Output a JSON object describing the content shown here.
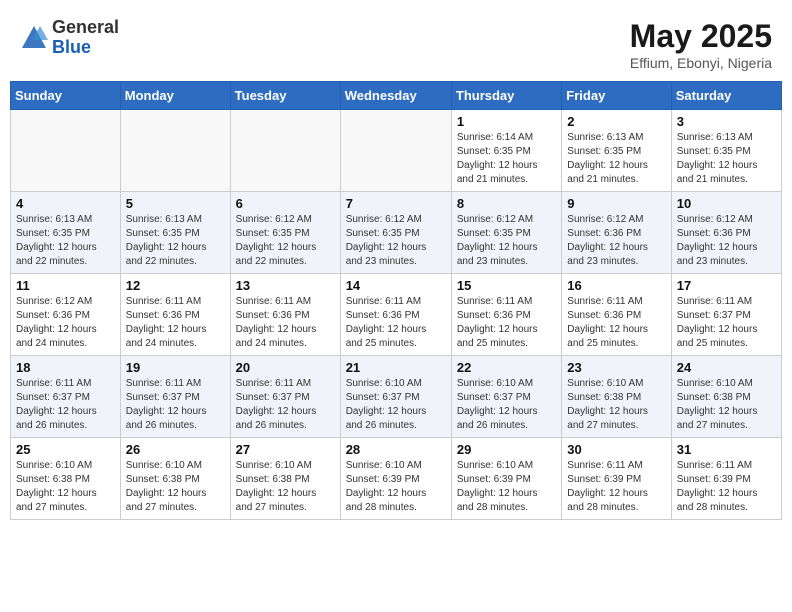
{
  "header": {
    "logo_general": "General",
    "logo_blue": "Blue",
    "month": "May 2025",
    "location": "Effium, Ebonyi, Nigeria"
  },
  "weekdays": [
    "Sunday",
    "Monday",
    "Tuesday",
    "Wednesday",
    "Thursday",
    "Friday",
    "Saturday"
  ],
  "weeks": [
    [
      {
        "day": "",
        "info": ""
      },
      {
        "day": "",
        "info": ""
      },
      {
        "day": "",
        "info": ""
      },
      {
        "day": "",
        "info": ""
      },
      {
        "day": "1",
        "info": "Sunrise: 6:14 AM\nSunset: 6:35 PM\nDaylight: 12 hours\nand 21 minutes."
      },
      {
        "day": "2",
        "info": "Sunrise: 6:13 AM\nSunset: 6:35 PM\nDaylight: 12 hours\nand 21 minutes."
      },
      {
        "day": "3",
        "info": "Sunrise: 6:13 AM\nSunset: 6:35 PM\nDaylight: 12 hours\nand 21 minutes."
      }
    ],
    [
      {
        "day": "4",
        "info": "Sunrise: 6:13 AM\nSunset: 6:35 PM\nDaylight: 12 hours\nand 22 minutes."
      },
      {
        "day": "5",
        "info": "Sunrise: 6:13 AM\nSunset: 6:35 PM\nDaylight: 12 hours\nand 22 minutes."
      },
      {
        "day": "6",
        "info": "Sunrise: 6:12 AM\nSunset: 6:35 PM\nDaylight: 12 hours\nand 22 minutes."
      },
      {
        "day": "7",
        "info": "Sunrise: 6:12 AM\nSunset: 6:35 PM\nDaylight: 12 hours\nand 23 minutes."
      },
      {
        "day": "8",
        "info": "Sunrise: 6:12 AM\nSunset: 6:35 PM\nDaylight: 12 hours\nand 23 minutes."
      },
      {
        "day": "9",
        "info": "Sunrise: 6:12 AM\nSunset: 6:36 PM\nDaylight: 12 hours\nand 23 minutes."
      },
      {
        "day": "10",
        "info": "Sunrise: 6:12 AM\nSunset: 6:36 PM\nDaylight: 12 hours\nand 23 minutes."
      }
    ],
    [
      {
        "day": "11",
        "info": "Sunrise: 6:12 AM\nSunset: 6:36 PM\nDaylight: 12 hours\nand 24 minutes."
      },
      {
        "day": "12",
        "info": "Sunrise: 6:11 AM\nSunset: 6:36 PM\nDaylight: 12 hours\nand 24 minutes."
      },
      {
        "day": "13",
        "info": "Sunrise: 6:11 AM\nSunset: 6:36 PM\nDaylight: 12 hours\nand 24 minutes."
      },
      {
        "day": "14",
        "info": "Sunrise: 6:11 AM\nSunset: 6:36 PM\nDaylight: 12 hours\nand 25 minutes."
      },
      {
        "day": "15",
        "info": "Sunrise: 6:11 AM\nSunset: 6:36 PM\nDaylight: 12 hours\nand 25 minutes."
      },
      {
        "day": "16",
        "info": "Sunrise: 6:11 AM\nSunset: 6:36 PM\nDaylight: 12 hours\nand 25 minutes."
      },
      {
        "day": "17",
        "info": "Sunrise: 6:11 AM\nSunset: 6:37 PM\nDaylight: 12 hours\nand 25 minutes."
      }
    ],
    [
      {
        "day": "18",
        "info": "Sunrise: 6:11 AM\nSunset: 6:37 PM\nDaylight: 12 hours\nand 26 minutes."
      },
      {
        "day": "19",
        "info": "Sunrise: 6:11 AM\nSunset: 6:37 PM\nDaylight: 12 hours\nand 26 minutes."
      },
      {
        "day": "20",
        "info": "Sunrise: 6:11 AM\nSunset: 6:37 PM\nDaylight: 12 hours\nand 26 minutes."
      },
      {
        "day": "21",
        "info": "Sunrise: 6:10 AM\nSunset: 6:37 PM\nDaylight: 12 hours\nand 26 minutes."
      },
      {
        "day": "22",
        "info": "Sunrise: 6:10 AM\nSunset: 6:37 PM\nDaylight: 12 hours\nand 26 minutes."
      },
      {
        "day": "23",
        "info": "Sunrise: 6:10 AM\nSunset: 6:38 PM\nDaylight: 12 hours\nand 27 minutes."
      },
      {
        "day": "24",
        "info": "Sunrise: 6:10 AM\nSunset: 6:38 PM\nDaylight: 12 hours\nand 27 minutes."
      }
    ],
    [
      {
        "day": "25",
        "info": "Sunrise: 6:10 AM\nSunset: 6:38 PM\nDaylight: 12 hours\nand 27 minutes."
      },
      {
        "day": "26",
        "info": "Sunrise: 6:10 AM\nSunset: 6:38 PM\nDaylight: 12 hours\nand 27 minutes."
      },
      {
        "day": "27",
        "info": "Sunrise: 6:10 AM\nSunset: 6:38 PM\nDaylight: 12 hours\nand 27 minutes."
      },
      {
        "day": "28",
        "info": "Sunrise: 6:10 AM\nSunset: 6:39 PM\nDaylight: 12 hours\nand 28 minutes."
      },
      {
        "day": "29",
        "info": "Sunrise: 6:10 AM\nSunset: 6:39 PM\nDaylight: 12 hours\nand 28 minutes."
      },
      {
        "day": "30",
        "info": "Sunrise: 6:11 AM\nSunset: 6:39 PM\nDaylight: 12 hours\nand 28 minutes."
      },
      {
        "day": "31",
        "info": "Sunrise: 6:11 AM\nSunset: 6:39 PM\nDaylight: 12 hours\nand 28 minutes."
      }
    ]
  ]
}
